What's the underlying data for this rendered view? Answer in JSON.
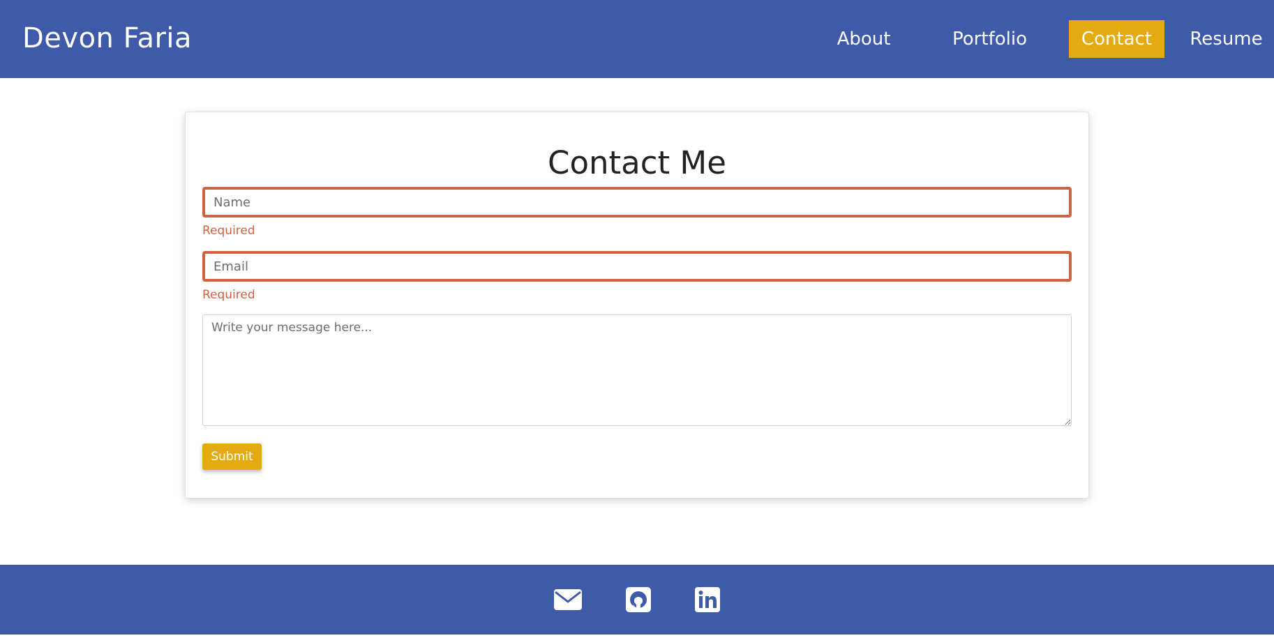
{
  "header": {
    "brand": "Devon Faria",
    "nav": [
      {
        "label": "About"
      },
      {
        "label": "Portfolio"
      },
      {
        "label": "Contact",
        "active": true
      },
      {
        "label": "Resume"
      }
    ]
  },
  "contact": {
    "title": "Contact Me",
    "name_placeholder": "Name",
    "email_placeholder": "Email",
    "message_placeholder": "Write your message here...",
    "name_error": "Required",
    "email_error": "Required",
    "submit_label": "Submit"
  },
  "footer": {
    "icons": [
      "envelope-icon",
      "github-icon",
      "linkedin-icon"
    ]
  },
  "colors": {
    "header_bg": "#3f5aa9",
    "accent": "#e4ab10",
    "error": "#cf6141"
  }
}
